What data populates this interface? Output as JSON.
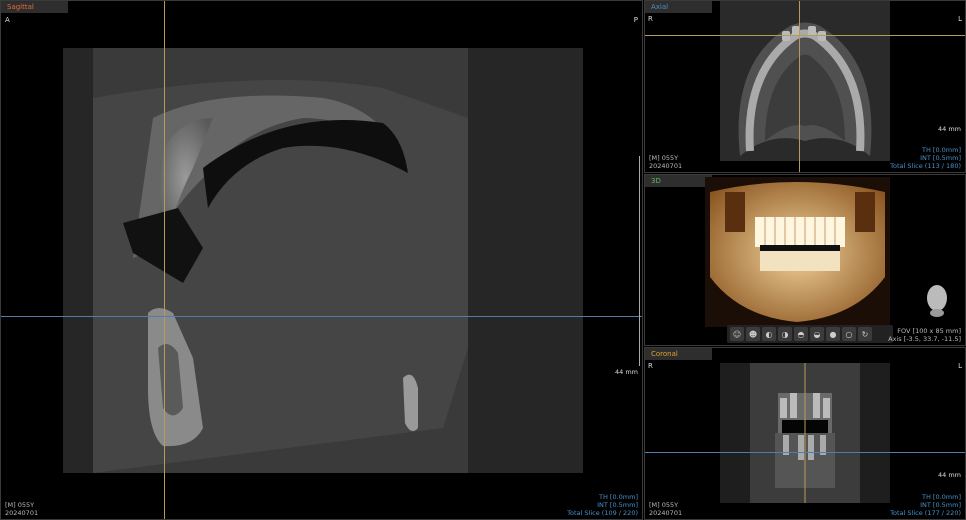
{
  "sagittal": {
    "tab": "Sagittal",
    "tab_color": "#e06c3c",
    "left_letter": "A",
    "right_letter": "P",
    "scale": "44 mm",
    "info_left": [
      "[M] 055Y",
      "20240701"
    ],
    "info_right": [
      "TH [0.0mm]",
      "INT [0.5mm]",
      "Total Slice (109 / 220)"
    ]
  },
  "axial": {
    "tab": "Axial",
    "tab_color": "#4a90c8",
    "left_letter": "R",
    "right_letter": "L",
    "scale": "44 mm",
    "info_left": [
      "[M] 055Y",
      "20240701"
    ],
    "info_right": [
      "TH [0.0mm]",
      "INT [0.5mm]",
      "Total Slice (113 / 180)"
    ]
  },
  "view3d": {
    "tab": "3D",
    "tab_color": "#5cb85c",
    "info_right": [
      "FOV [100 x 85 mm]",
      "Axis [-3.5, 33.7, -11.5]"
    ],
    "toolbar_icons": [
      "view-front-icon",
      "view-back-icon",
      "view-left-icon",
      "view-right-icon",
      "view-top-icon",
      "view-bottom-icon",
      "view-iso-icon",
      "view-reset-icon",
      "rotate-icon"
    ]
  },
  "coronal": {
    "tab": "Coronal",
    "tab_color": "#e0a030",
    "left_letter": "R",
    "right_letter": "L",
    "scale": "44 mm",
    "info_left": [
      "[M] 055Y",
      "20240701"
    ],
    "info_right": [
      "TH [0.0mm]",
      "INT [0.5mm]",
      "Total Slice (177 / 220)"
    ]
  },
  "colors": {
    "crosshair_v": "#b89a5a",
    "crosshair_h": "#4a7fb0",
    "info_blue": "#4a90c8"
  }
}
